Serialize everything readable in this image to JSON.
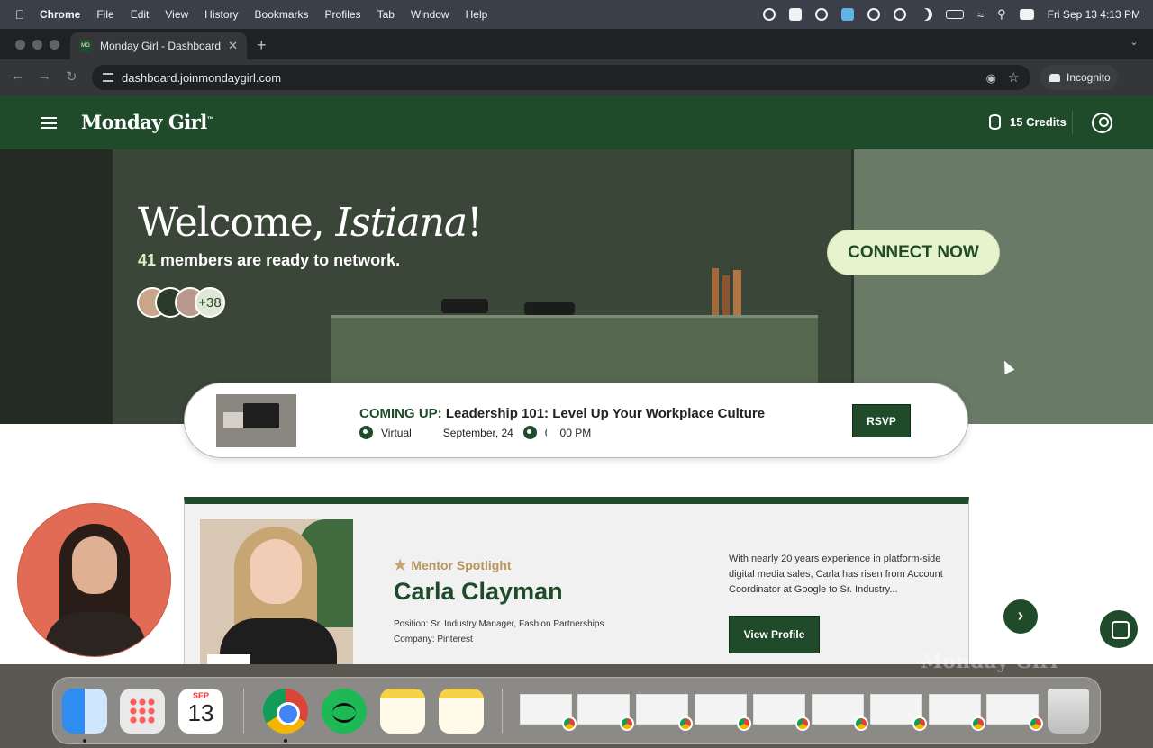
{
  "menubar": {
    "app_name": "Chrome",
    "items": [
      "File",
      "Edit",
      "View",
      "History",
      "Bookmarks",
      "Profiles",
      "Tab",
      "Window",
      "Help"
    ],
    "clock": "Fri Sep 13  4:13 PM",
    "status_icons": [
      "grammarly-icon",
      "dropbox-icon",
      "creative-cloud-icon",
      "app-icon",
      "gear-icon",
      "brightness-icon",
      "moon-icon",
      "battery-icon",
      "wifi-icon",
      "search-icon",
      "control-center-icon"
    ]
  },
  "browser": {
    "tab_title": "Monday Girl - Dashboard",
    "favicon_text": "MG",
    "url": "dashboard.joinmondaygirl.com",
    "profile_label": "Incognito"
  },
  "site": {
    "logo": "Monday Girl",
    "logo_mark": "™",
    "credits": "15 Credits",
    "brand_color": "#1f4b2b"
  },
  "hero": {
    "welcome_prefix": "Welcome, ",
    "user_name": "Istiana",
    "welcome_suffix": "!",
    "members_count": "41",
    "members_text": " members are ready to network.",
    "more_avatars": "+38",
    "cta": "CONNECT NOW"
  },
  "event": {
    "prefix": "COMING UP:",
    "title": " Leadership 101: Level Up Your Workplace Culture",
    "location": "Virtual",
    "date": "September, 24",
    "time": "06:00 PM",
    "cta": "RSVP"
  },
  "mentor": {
    "badge": "Mentor Spotlight",
    "name": "Carla Clayman",
    "position": "Position: Sr. Industry Manager, Fashion Partnerships",
    "company": "Company: Pinterest",
    "bio": "With nearly 20 years experience in platform-side digital media sales, Carla has risen from Account Coordinator at Google to Sr. Industry...",
    "cta": "View Profile"
  },
  "dock": {
    "calendar_month": "SEP",
    "calendar_day": "13",
    "watermark": "Monday Girl"
  }
}
